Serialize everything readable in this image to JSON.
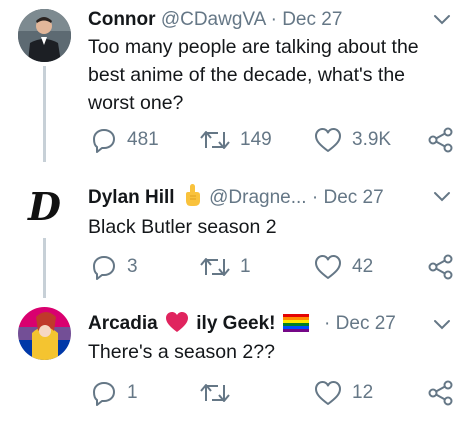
{
  "tweets": [
    {
      "name": "Connor",
      "handle": "@CDawgVA",
      "separator": "·",
      "date": "Dec 27",
      "text": "Too many people are talking about the best anime of the decade, what's the worst one?",
      "reply_count": "481",
      "retweet_count": "149",
      "like_count": "3.9K"
    },
    {
      "name": "Dylan Hill",
      "name_emoji": "pointing-up-hand",
      "handle": "@Dragne...",
      "separator": "·",
      "date": "Dec 27",
      "text": "Black Butler season 2",
      "reply_count": "3",
      "retweet_count": "1",
      "like_count": "42"
    },
    {
      "name_before": "Arcadia",
      "name_after": "ily Geek!",
      "name_emojis": [
        "red-heart",
        "rainbow-flag"
      ],
      "separator": "·",
      "date": "Dec 27",
      "text": "There's a season 2??",
      "reply_count": "1",
      "retweet_count": "",
      "like_count": "12"
    }
  ],
  "colors": {
    "text_primary": "#14171a",
    "text_secondary": "#657786",
    "icon": "#657786",
    "thread_line": "#c7d0d7",
    "heart_emoji": "#e0245e"
  }
}
